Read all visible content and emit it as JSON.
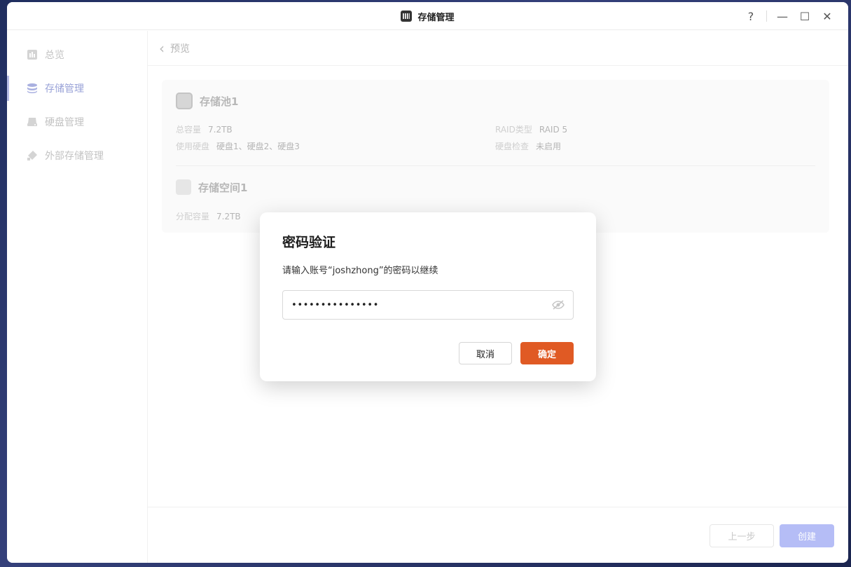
{
  "window": {
    "title": "存储管理",
    "help_glyph": "?",
    "minimize_glyph": "—",
    "maximize_glyph": "☐",
    "close_glyph": "✕"
  },
  "sidebar": {
    "items": [
      {
        "label": "总览",
        "icon": "overview-icon",
        "active": false
      },
      {
        "label": "存储管理",
        "icon": "storage-icon",
        "active": true
      },
      {
        "label": "硬盘管理",
        "icon": "disk-icon",
        "active": false
      },
      {
        "label": "外部存储管理",
        "icon": "external-storage-icon",
        "active": false
      }
    ]
  },
  "breadcrumb": {
    "back_glyph": "‹",
    "label": "预览"
  },
  "pool": {
    "name": "存储池1",
    "total_capacity_label": "总容量",
    "total_capacity_value": "7.2TB",
    "disks_label": "使用硬盘",
    "disks_value": "硬盘1、硬盘2、硬盘3",
    "raid_label": "RAID类型",
    "raid_value": "RAID 5",
    "check_label": "硬盘检查",
    "check_value": "未启用"
  },
  "space": {
    "name": "存储空间1",
    "alloc_label": "分配容量",
    "alloc_value": "7.2TB"
  },
  "footer": {
    "prev_label": "上一步",
    "create_label": "创建"
  },
  "dialog": {
    "title": "密码验证",
    "description": "请输入账号“joshzhong”的密码以继续",
    "password_value": "•••••••••••••••",
    "cancel_label": "取消",
    "confirm_label": "确定"
  },
  "colors": {
    "accent": "#e05a24",
    "active_nav": "#9aa3d8",
    "create_disabled": "#b5bdf6"
  }
}
